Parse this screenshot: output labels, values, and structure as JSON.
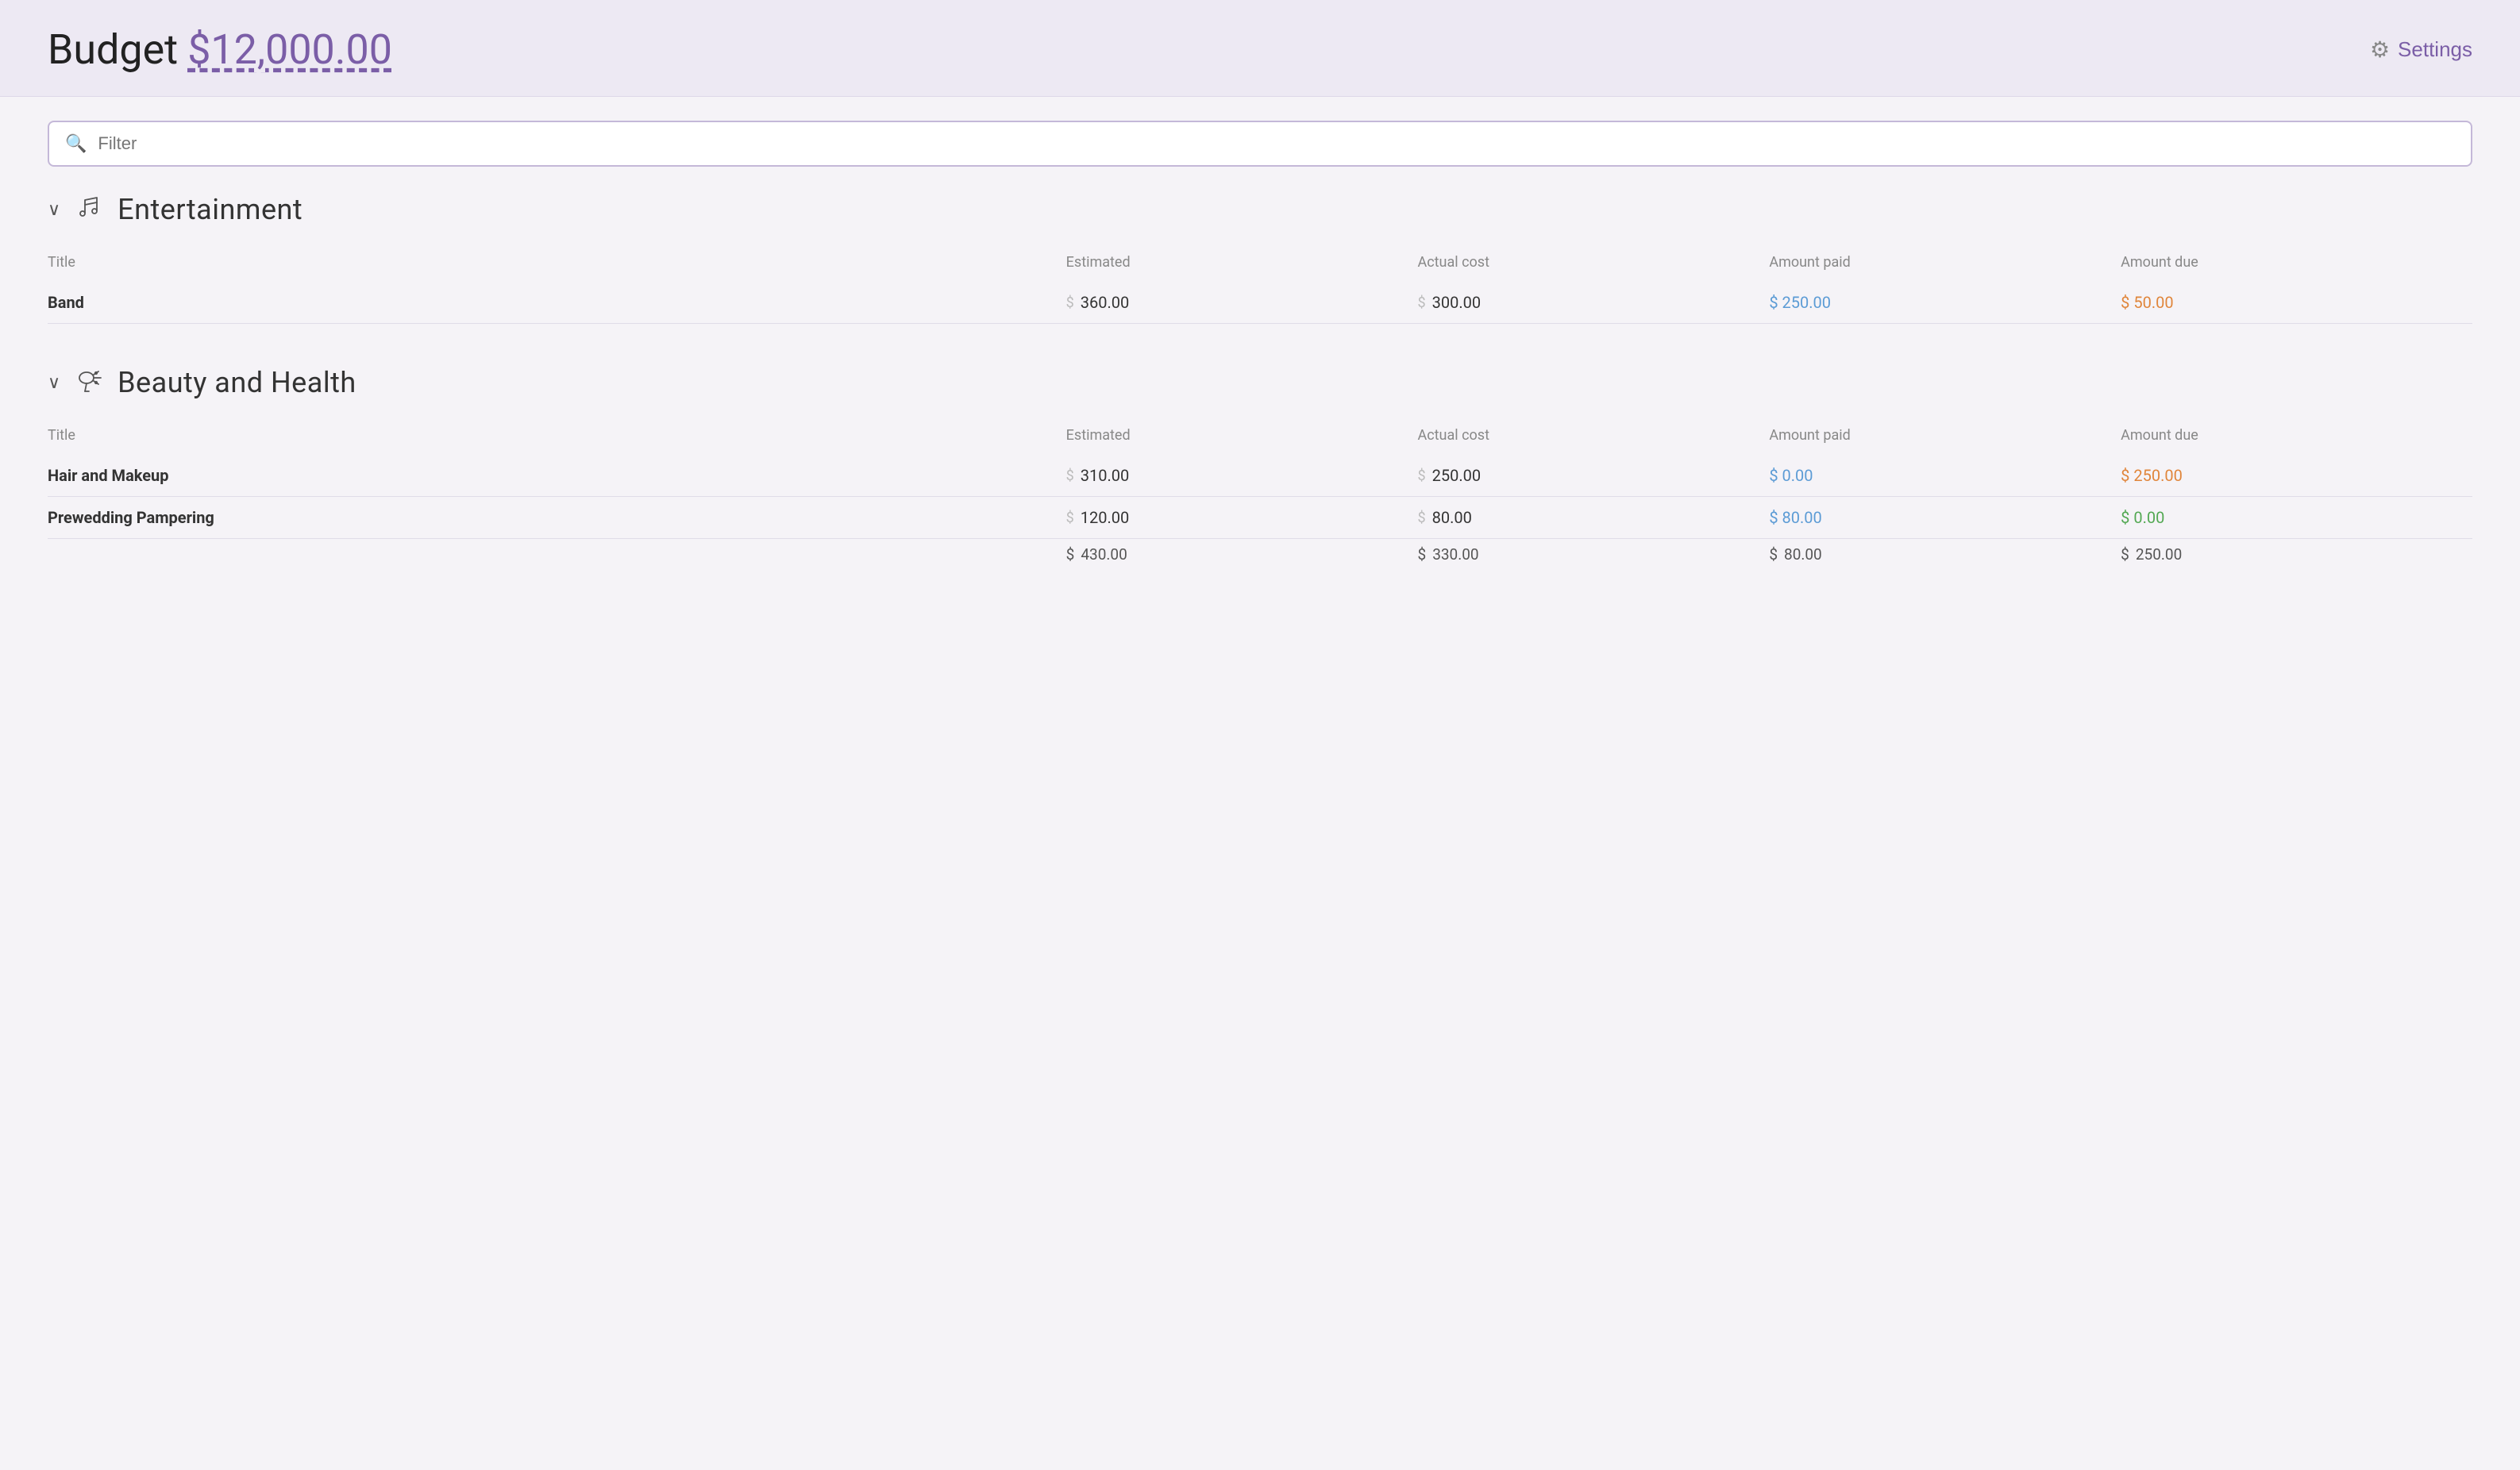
{
  "header": {
    "budget_label": "Budget",
    "budget_amount": "$12,000.00",
    "settings_label": "Settings"
  },
  "filter": {
    "placeholder": "Filter"
  },
  "categories": [
    {
      "id": "entertainment",
      "name": "Entertainment",
      "icon": "music-icon",
      "expanded": true,
      "columns": {
        "title": "Title",
        "estimated": "Estimated",
        "actual_cost": "Actual cost",
        "amount_paid": "Amount paid",
        "amount_due": "Amount due"
      },
      "items": [
        {
          "title": "Band",
          "estimated": "360.00",
          "actual_cost": "300.00",
          "amount_paid": "250.00",
          "amount_due": "50.00",
          "paid_color": "blue",
          "due_color": "orange"
        }
      ],
      "totals": null
    },
    {
      "id": "beauty-and-health",
      "name": "Beauty and Health",
      "icon": "hairdryer-icon",
      "expanded": true,
      "columns": {
        "title": "Title",
        "estimated": "Estimated",
        "actual_cost": "Actual cost",
        "amount_paid": "Amount paid",
        "amount_due": "Amount due"
      },
      "items": [
        {
          "title": "Hair and Makeup",
          "estimated": "310.00",
          "actual_cost": "250.00",
          "amount_paid": "0.00",
          "amount_due": "250.00",
          "paid_color": "blue",
          "due_color": "orange"
        },
        {
          "title": "Prewedding Pampering",
          "estimated": "120.00",
          "actual_cost": "80.00",
          "amount_paid": "80.00",
          "amount_due": "0.00",
          "paid_color": "blue",
          "due_color": "green"
        }
      ],
      "totals": {
        "estimated": "430.00",
        "actual_cost": "330.00",
        "amount_paid": "80.00",
        "amount_due": "250.00"
      }
    }
  ]
}
